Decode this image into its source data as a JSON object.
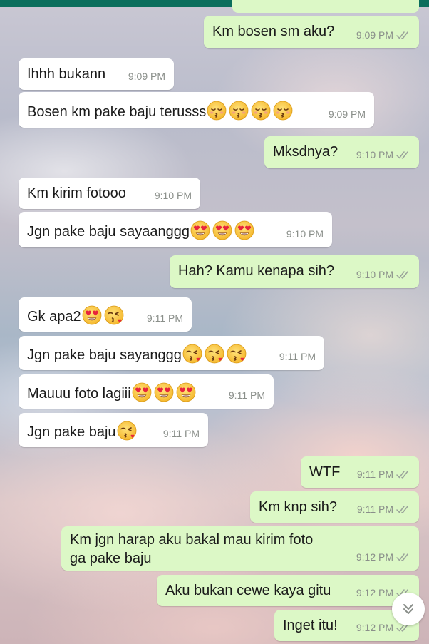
{
  "chat": {
    "messages": [
      {
        "dir": "out",
        "text": "Km bosen sm aku?",
        "time": "9:09 PM",
        "ticks": "read"
      },
      {
        "dir": "in",
        "text": "Ihhh bukann",
        "time": "9:09 PM"
      },
      {
        "dir": "in",
        "text": "Bosen km pake baju terusss",
        "emoji": [
          "kissing-closed-eyes",
          "kissing-closed-eyes",
          "kissing-closed-eyes",
          "kissing-closed-eyes"
        ],
        "time": "9:09 PM"
      },
      {
        "dir": "out",
        "text": "Mksdnya?",
        "time": "9:10 PM",
        "ticks": "read"
      },
      {
        "dir": "in",
        "text": "Km kirim fotooo",
        "time": "9:10 PM"
      },
      {
        "dir": "in",
        "text": "Jgn pake baju sayaanggg",
        "emoji": [
          "heart-eyes",
          "heart-eyes",
          "heart-eyes"
        ],
        "time": "9:10 PM"
      },
      {
        "dir": "out",
        "text": "Hah? Kamu kenapa sih?",
        "time": "9:10 PM",
        "ticks": "read"
      },
      {
        "dir": "in",
        "text": "Gk apa2",
        "emoji": [
          "heart-eyes",
          "blowing-kiss"
        ],
        "time": "9:11 PM"
      },
      {
        "dir": "in",
        "text": "Jgn pake baju sayanggg",
        "emoji": [
          "blowing-kiss",
          "blowing-kiss",
          "blowing-kiss"
        ],
        "time": "9:11 PM"
      },
      {
        "dir": "in",
        "text": "Mauuu foto lagiii",
        "emoji": [
          "heart-eyes",
          "heart-eyes",
          "heart-eyes"
        ],
        "time": "9:11 PM"
      },
      {
        "dir": "in",
        "text": "Jgn pake baju",
        "emoji": [
          "blowing-kiss"
        ],
        "time": "9:11 PM"
      },
      {
        "dir": "out",
        "text": "WTF",
        "time": "9:11 PM",
        "ticks": "read"
      },
      {
        "dir": "out",
        "text": "Km knp sih?",
        "time": "9:11 PM",
        "ticks": "read"
      },
      {
        "dir": "out",
        "lines": [
          "Km jgn harap aku bakal mau kirim foto",
          "ga pake baju"
        ],
        "time": "9:12 PM",
        "ticks": "read"
      },
      {
        "dir": "out",
        "text": "Aku bukan cewe kaya gitu",
        "time": "9:12 PM",
        "ticks": "read"
      },
      {
        "dir": "out",
        "text": "Inget itu!",
        "time": "9:12 PM",
        "ticks": "read"
      }
    ]
  },
  "colors": {
    "incoming_bubble": "#ffffff",
    "outgoing_bubble": "#dcf8c6",
    "header": "#0b6e5c",
    "read_ticks": "#9aa39a"
  },
  "scroll_button": {
    "icon": "double-chevron-down-icon"
  }
}
